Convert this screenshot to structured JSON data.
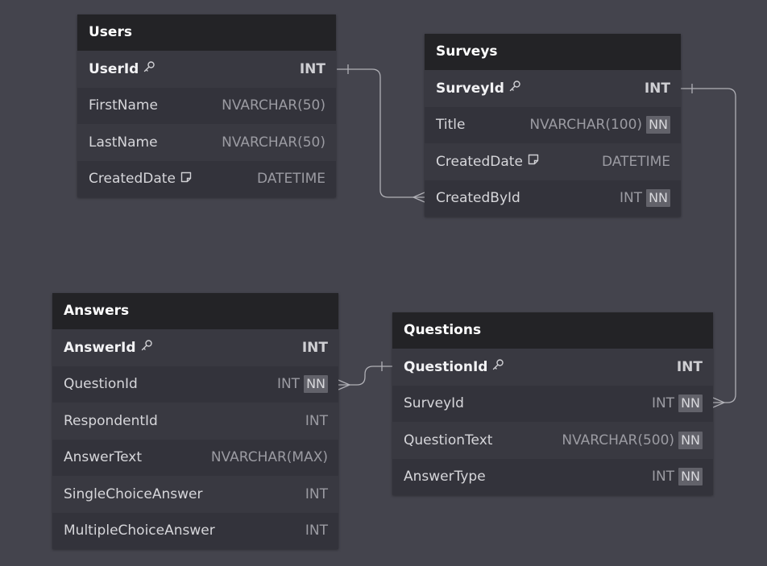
{
  "tables": {
    "users": {
      "name": "Users",
      "columns": [
        {
          "name": "UserId",
          "type": "INT",
          "pk": true,
          "icon": "key-icon"
        },
        {
          "name": "FirstName",
          "type": "NVARCHAR(50)"
        },
        {
          "name": "LastName",
          "type": "NVARCHAR(50)"
        },
        {
          "name": "CreatedDate",
          "type": "DATETIME",
          "icon": "note-icon"
        }
      ]
    },
    "surveys": {
      "name": "Surveys",
      "columns": [
        {
          "name": "SurveyId",
          "type": "INT",
          "pk": true,
          "icon": "key-icon"
        },
        {
          "name": "Title",
          "type": "NVARCHAR(100)",
          "nn": "NN"
        },
        {
          "name": "CreatedDate",
          "type": "DATETIME",
          "icon": "note-icon"
        },
        {
          "name": "CreatedById",
          "type": "INT",
          "nn": "NN"
        }
      ]
    },
    "answers": {
      "name": "Answers",
      "columns": [
        {
          "name": "AnswerId",
          "type": "INT",
          "pk": true,
          "icon": "key-icon"
        },
        {
          "name": "QuestionId",
          "type": "INT",
          "nn": "NN"
        },
        {
          "name": "RespondentId",
          "type": "INT"
        },
        {
          "name": "AnswerText",
          "type": "NVARCHAR(MAX)"
        },
        {
          "name": "SingleChoiceAnswer",
          "type": "INT"
        },
        {
          "name": "MultipleChoiceAnswer",
          "type": "INT"
        }
      ]
    },
    "questions": {
      "name": "Questions",
      "columns": [
        {
          "name": "QuestionId",
          "type": "INT",
          "pk": true,
          "icon": "key-icon"
        },
        {
          "name": "SurveyId",
          "type": "INT",
          "nn": "NN"
        },
        {
          "name": "QuestionText",
          "type": "NVARCHAR(500)",
          "nn": "NN"
        },
        {
          "name": "AnswerType",
          "type": "INT",
          "nn": "NN"
        }
      ]
    }
  },
  "relationships": [
    {
      "from": "users.UserId",
      "to": "surveys.CreatedById",
      "cardinality": "one-to-many"
    },
    {
      "from": "surveys.SurveyId",
      "to": "questions.SurveyId",
      "cardinality": "one-to-many"
    },
    {
      "from": "questions.QuestionId",
      "to": "answers.QuestionId",
      "cardinality": "one-to-many"
    }
  ],
  "colors": {
    "canvas": "#44444d",
    "header": "#232326",
    "row_odd": "#393941",
    "row_even": "#33333b",
    "connector": "#b0b0b6",
    "nn_badge": "#62626a"
  }
}
